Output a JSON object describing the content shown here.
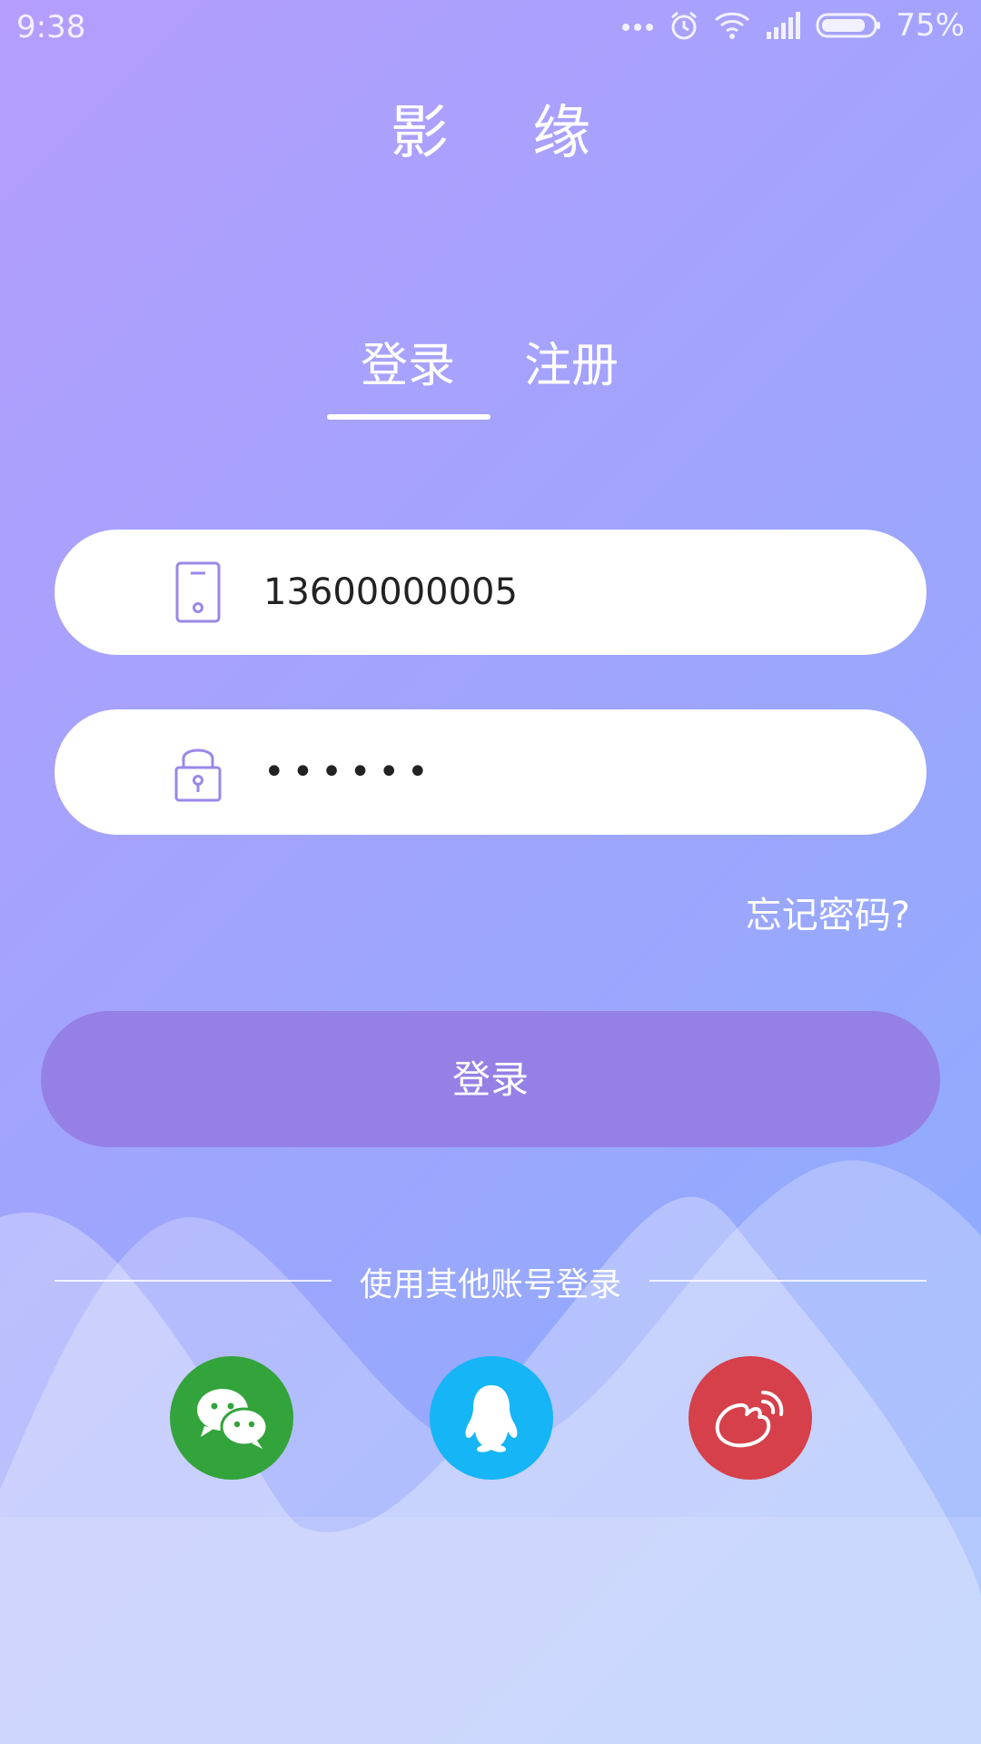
{
  "status_bar": {
    "time": "9:38",
    "battery_percent": "75%",
    "icons": [
      "more-dots-icon",
      "alarm-icon",
      "wifi-icon",
      "signal-icon",
      "battery-icon"
    ]
  },
  "app": {
    "title": "影 缘"
  },
  "tabs": [
    {
      "label": "登录",
      "selected": true
    },
    {
      "label": "注册",
      "selected": false
    }
  ],
  "form": {
    "phone": {
      "value": "13600000005",
      "icon": "phone-icon"
    },
    "password": {
      "masked_value": "••••••",
      "icon": "lock-icon"
    },
    "forgot_password_label": "忘记密码?",
    "submit_label": "登录"
  },
  "other_login": {
    "label": "使用其他账号登录",
    "providers": [
      {
        "icon": "wechat-icon",
        "color": "#33a33b"
      },
      {
        "icon": "qq-icon",
        "color": "#16b5f5"
      },
      {
        "icon": "weibo-icon",
        "color": "#d5404a"
      }
    ]
  },
  "colors": {
    "gradient_start": "#b49dfd",
    "gradient_end": "#8aaefd",
    "button": "#9580e5",
    "icon_stroke": "#9b87e8"
  }
}
